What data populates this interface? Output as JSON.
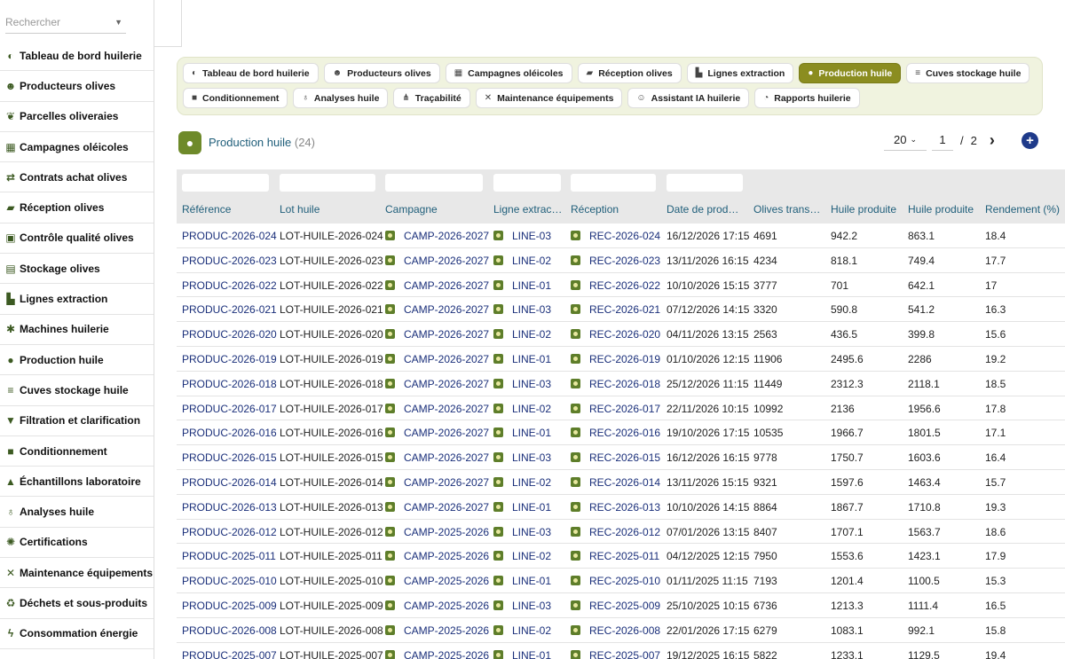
{
  "sidebar": {
    "search_placeholder": "Rechercher",
    "items": [
      {
        "label": "Tableau de bord huilerie",
        "icon": "dashboard-icon",
        "glyph": "◐"
      },
      {
        "label": "Producteurs olives",
        "icon": "users-icon",
        "glyph": "☻"
      },
      {
        "label": "Parcelles oliveraies",
        "icon": "seedling-icon",
        "glyph": "❦"
      },
      {
        "label": "Campagnes oléicoles",
        "icon": "calendar-icon",
        "glyph": "▦"
      },
      {
        "label": "Contrats achat olives",
        "icon": "handshake-icon",
        "glyph": "⇄"
      },
      {
        "label": "Réception olives",
        "icon": "truck-icon",
        "glyph": "▰"
      },
      {
        "label": "Contrôle qualité olives",
        "icon": "clipboard-check-icon",
        "glyph": "▣"
      },
      {
        "label": "Stockage olives",
        "icon": "boxes-icon",
        "glyph": "▤"
      },
      {
        "label": "Lignes extraction",
        "icon": "industry-icon",
        "glyph": "▙"
      },
      {
        "label": "Machines huilerie",
        "icon": "cogs-icon",
        "glyph": "✱"
      },
      {
        "label": "Production huile",
        "icon": "oil-drop-icon",
        "glyph": "●"
      },
      {
        "label": "Cuves stockage huile",
        "icon": "database-icon",
        "glyph": "≡"
      },
      {
        "label": "Filtration et clarification",
        "icon": "filter-icon",
        "glyph": "▼"
      },
      {
        "label": "Conditionnement",
        "icon": "box-icon",
        "glyph": "■"
      },
      {
        "label": "Échantillons laboratoire",
        "icon": "flask-icon",
        "glyph": "▲"
      },
      {
        "label": "Analyses huile",
        "icon": "microscope-icon",
        "glyph": "♁"
      },
      {
        "label": "Certifications",
        "icon": "certificate-icon",
        "glyph": "✺"
      },
      {
        "label": "Maintenance équipements",
        "icon": "tools-icon",
        "glyph": "✕"
      },
      {
        "label": "Déchets et sous-produits",
        "icon": "recycle-icon",
        "glyph": "♻"
      },
      {
        "label": "Consommation énergie",
        "icon": "bolt-icon",
        "glyph": "ϟ"
      }
    ]
  },
  "tabs": {
    "row1": [
      {
        "label": "Tableau de bord huilerie",
        "icon": "dashboard-icon",
        "glyph": "◐",
        "active": false
      },
      {
        "label": "Producteurs olives",
        "icon": "users-icon",
        "glyph": "☻",
        "active": false
      },
      {
        "label": "Campagnes oléicoles",
        "icon": "calendar-icon",
        "glyph": "▦",
        "active": false
      },
      {
        "label": "Réception olives",
        "icon": "truck-icon",
        "glyph": "▰",
        "active": false
      },
      {
        "label": "Lignes extraction",
        "icon": "industry-icon",
        "glyph": "▙",
        "active": false
      },
      {
        "label": "Production huile",
        "icon": "oil-drop-icon",
        "glyph": "●",
        "active": true
      },
      {
        "label": "Cuves stockage huile",
        "icon": "database-icon",
        "glyph": "≡",
        "active": false
      }
    ],
    "row2": [
      {
        "label": "Conditionnement",
        "icon": "box-icon",
        "glyph": "■",
        "active": false
      },
      {
        "label": "Analyses huile",
        "icon": "microscope-icon",
        "glyph": "♁",
        "active": false
      },
      {
        "label": "Traçabilité",
        "icon": "sitemap-icon",
        "glyph": "⋔",
        "active": false
      },
      {
        "label": "Maintenance équipements",
        "icon": "tools-icon",
        "glyph": "✕",
        "active": false
      },
      {
        "label": "Assistant IA huilerie",
        "icon": "robot-icon",
        "glyph": "☺",
        "active": false
      },
      {
        "label": "Rapports huilerie",
        "icon": "chart-pie-icon",
        "glyph": "◔",
        "active": false
      }
    ]
  },
  "header": {
    "title": "Production huile",
    "count": "(24)"
  },
  "pager": {
    "page_size": "20",
    "current_page": "1",
    "separator": "/",
    "total_pages": "2",
    "next_glyph": "›",
    "add_glyph": "+"
  },
  "table": {
    "columns": [
      "Référence",
      "Lot huile",
      "Campagne",
      "Ligne extraction",
      "Réception",
      "Date de production",
      "Olives transformées",
      "Huile produite",
      "Huile produite",
      "Rendement (%)"
    ],
    "rows": [
      [
        "PRODUC-2026-024",
        "LOT-HUILE-2026-024",
        "CAMP-2026-2027",
        "LINE-03",
        "REC-2026-024",
        "16/12/2026 17:15",
        "4691",
        "942.2",
        "863.1",
        "18.4"
      ],
      [
        "PRODUC-2026-023",
        "LOT-HUILE-2026-023",
        "CAMP-2026-2027",
        "LINE-02",
        "REC-2026-023",
        "13/11/2026 16:15",
        "4234",
        "818.1",
        "749.4",
        "17.7"
      ],
      [
        "PRODUC-2026-022",
        "LOT-HUILE-2026-022",
        "CAMP-2026-2027",
        "LINE-01",
        "REC-2026-022",
        "10/10/2026 15:15",
        "3777",
        "701",
        "642.1",
        "17"
      ],
      [
        "PRODUC-2026-021",
        "LOT-HUILE-2026-021",
        "CAMP-2026-2027",
        "LINE-03",
        "REC-2026-021",
        "07/12/2026 14:15",
        "3320",
        "590.8",
        "541.2",
        "16.3"
      ],
      [
        "PRODUC-2026-020",
        "LOT-HUILE-2026-020",
        "CAMP-2026-2027",
        "LINE-02",
        "REC-2026-020",
        "04/11/2026 13:15",
        "2563",
        "436.5",
        "399.8",
        "15.6"
      ],
      [
        "PRODUC-2026-019",
        "LOT-HUILE-2026-019",
        "CAMP-2026-2027",
        "LINE-01",
        "REC-2026-019",
        "01/10/2026 12:15",
        "11906",
        "2495.6",
        "2286",
        "19.2"
      ],
      [
        "PRODUC-2026-018",
        "LOT-HUILE-2026-018",
        "CAMP-2026-2027",
        "LINE-03",
        "REC-2026-018",
        "25/12/2026 11:15",
        "11449",
        "2312.3",
        "2118.1",
        "18.5"
      ],
      [
        "PRODUC-2026-017",
        "LOT-HUILE-2026-017",
        "CAMP-2026-2027",
        "LINE-02",
        "REC-2026-017",
        "22/11/2026 10:15",
        "10992",
        "2136",
        "1956.6",
        "17.8"
      ],
      [
        "PRODUC-2026-016",
        "LOT-HUILE-2026-016",
        "CAMP-2026-2027",
        "LINE-01",
        "REC-2026-016",
        "19/10/2026 17:15",
        "10535",
        "1966.7",
        "1801.5",
        "17.1"
      ],
      [
        "PRODUC-2026-015",
        "LOT-HUILE-2026-015",
        "CAMP-2026-2027",
        "LINE-03",
        "REC-2026-015",
        "16/12/2026 16:15",
        "9778",
        "1750.7",
        "1603.6",
        "16.4"
      ],
      [
        "PRODUC-2026-014",
        "LOT-HUILE-2026-014",
        "CAMP-2026-2027",
        "LINE-02",
        "REC-2026-014",
        "13/11/2026 15:15",
        "9321",
        "1597.6",
        "1463.4",
        "15.7"
      ],
      [
        "PRODUC-2026-013",
        "LOT-HUILE-2026-013",
        "CAMP-2026-2027",
        "LINE-01",
        "REC-2026-013",
        "10/10/2026 14:15",
        "8864",
        "1867.7",
        "1710.8",
        "19.3"
      ],
      [
        "PRODUC-2026-012",
        "LOT-HUILE-2026-012",
        "CAMP-2025-2026",
        "LINE-03",
        "REC-2026-012",
        "07/01/2026 13:15",
        "8407",
        "1707.1",
        "1563.7",
        "18.6"
      ],
      [
        "PRODUC-2025-011",
        "LOT-HUILE-2025-011",
        "CAMP-2025-2026",
        "LINE-02",
        "REC-2025-011",
        "04/12/2025 12:15",
        "7950",
        "1553.6",
        "1423.1",
        "17.9"
      ],
      [
        "PRODUC-2025-010",
        "LOT-HUILE-2025-010",
        "CAMP-2025-2026",
        "LINE-01",
        "REC-2025-010",
        "01/11/2025 11:15",
        "7193",
        "1201.4",
        "1100.5",
        "15.3"
      ],
      [
        "PRODUC-2025-009",
        "LOT-HUILE-2025-009",
        "CAMP-2025-2026",
        "LINE-03",
        "REC-2025-009",
        "25/10/2025 10:15",
        "6736",
        "1213.3",
        "1111.4",
        "16.5"
      ],
      [
        "PRODUC-2026-008",
        "LOT-HUILE-2026-008",
        "CAMP-2025-2026",
        "LINE-02",
        "REC-2026-008",
        "22/01/2026 17:15",
        "6279",
        "1083.1",
        "992.1",
        "15.8"
      ],
      [
        "PRODUC-2025-007",
        "LOT-HUILE-2025-007",
        "CAMP-2025-2026",
        "LINE-01",
        "REC-2025-007",
        "19/12/2025 16:15",
        "5822",
        "1233.1",
        "1129.5",
        "19.4"
      ]
    ]
  },
  "colors": {
    "accent": "#8b8d20",
    "link": "#1a2f7a",
    "header_text": "#1f5e7a",
    "icon_green": "#5e7e2a"
  }
}
